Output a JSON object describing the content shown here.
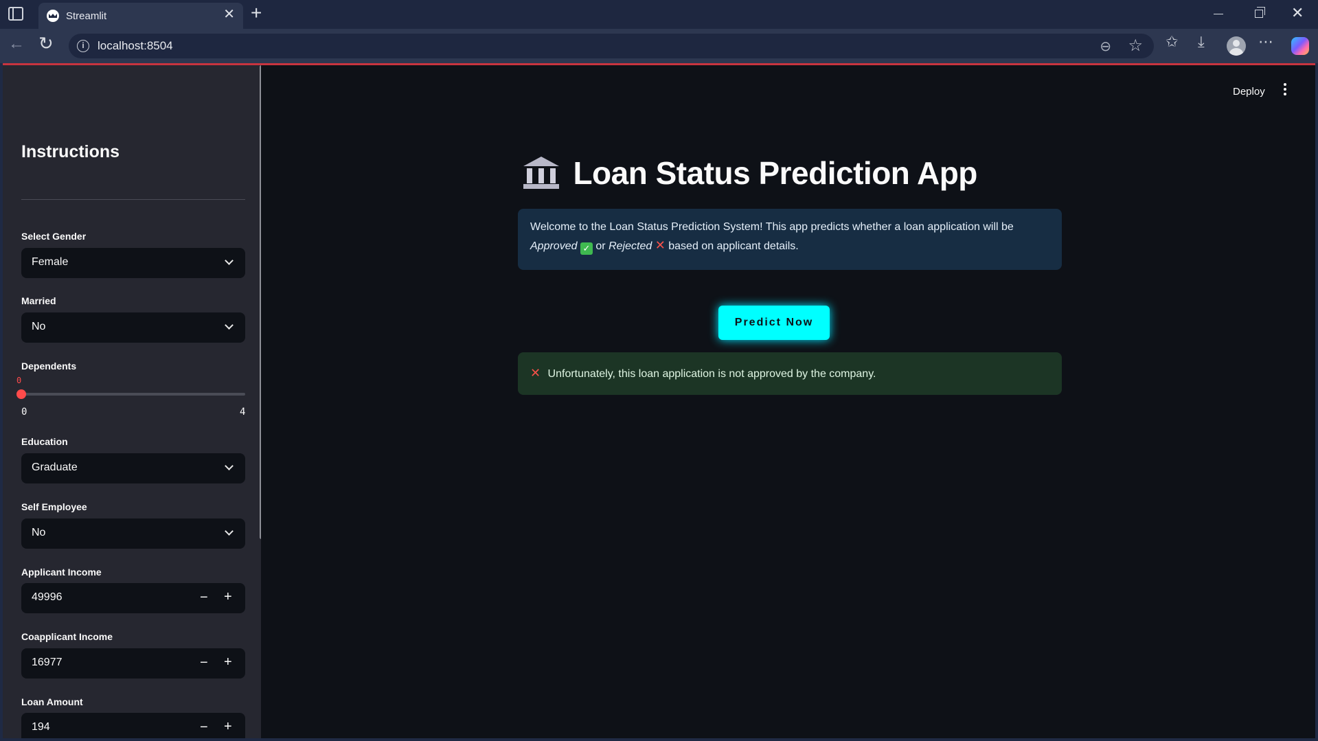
{
  "browser": {
    "tab_title": "Streamlit",
    "url": "localhost:8504"
  },
  "sidebar": {
    "title": "Instructions",
    "gender": {
      "label": "Select Gender",
      "value": "Female"
    },
    "married": {
      "label": "Married",
      "value": "No"
    },
    "dependents": {
      "label": "Dependents",
      "value": "0",
      "min": "0",
      "max": "4",
      "fraction": 0
    },
    "education": {
      "label": "Education",
      "value": "Graduate"
    },
    "self_employed": {
      "label": "Self Employee",
      "value": "No"
    },
    "applicant_income": {
      "label": "Applicant Income",
      "value": "49996"
    },
    "coapplicant_income": {
      "label": "Coapplicant Income",
      "value": "16977"
    },
    "loan_amount": {
      "label": "Loan Amount",
      "value": "194"
    },
    "minus": "−",
    "plus": "+"
  },
  "main": {
    "deploy_label": "Deploy",
    "title": "Loan Status Prediction App",
    "info_text_1": "Welcome to the Loan Status Prediction System! This app predicts whether a loan application will be",
    "approved": "Approved",
    "or": "or",
    "rejected": "Rejected",
    "info_text_2": "based on applicant details.",
    "predict_button": "Predict Now",
    "result_text": "Unfortunately, this loan application is not approved by the company."
  },
  "colors": {
    "accent_red": "#ff4b4b",
    "predict_cyan": "#00ffff",
    "info_bg": "#172d43",
    "result_bg": "#1c3525"
  }
}
